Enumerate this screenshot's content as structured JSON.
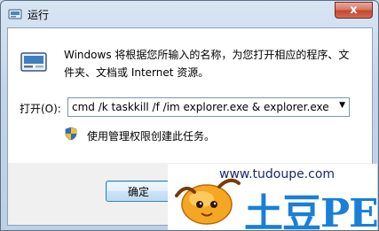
{
  "window": {
    "title": "运行",
    "close_glyph": "x"
  },
  "dialog": {
    "description": "Windows 将根据您所输入的名称，为您打开相应的程序、文件夹、文档或 Internet 资源。",
    "open_label": "打开(O):",
    "command_value": "cmd /k taskkill /f /im explorer.exe & explorer.exe",
    "admin_note": "使用管理权限创建此任务。",
    "ok_label": "确定"
  },
  "watermark": {
    "url": "www.tudoupe.com",
    "brand": "土豆PE"
  },
  "colors": {
    "brand_blue": "#1a7fd6",
    "mascot_orange": "#f5a623",
    "close_red": "#c2482d"
  },
  "icons": {
    "app": "run-dialog-icon",
    "large": "run-program-icon",
    "shield": "uac-shield-icon",
    "dropdown": "chevron-down-icon"
  }
}
